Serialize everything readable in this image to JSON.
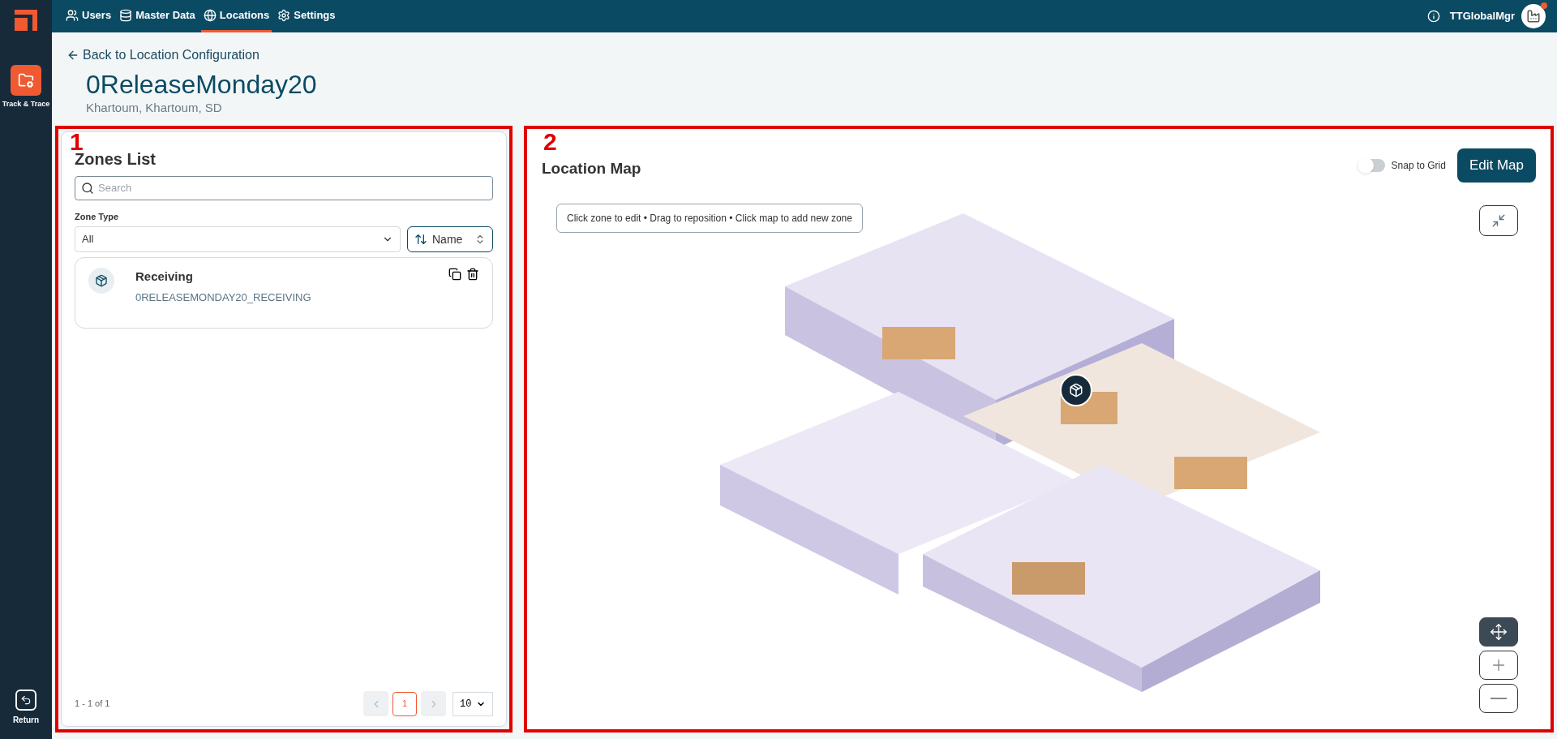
{
  "sidebar": {
    "apps": [
      {
        "label": "Track & Trace",
        "selected": true
      }
    ],
    "return_label": "Return"
  },
  "nav": {
    "tabs": [
      {
        "label": "Users",
        "selected": false
      },
      {
        "label": "Master Data",
        "selected": false
      },
      {
        "label": "Locations",
        "selected": true
      },
      {
        "label": "Settings",
        "selected": false
      }
    ],
    "user": "TTGlobalMgr",
    "notification": true
  },
  "back_link": "Back to Location Configuration",
  "location": {
    "title": "0ReleaseMonday20",
    "subtitle": "Khartoum, Khartoum, SD"
  },
  "annotations": [
    "1",
    "2"
  ],
  "zones_panel": {
    "title": "Zones List",
    "search": {
      "placeholder": "Search"
    },
    "zone_type_label": "Zone Type",
    "zone_type_value": "All",
    "sort_label": "Name",
    "zones": [
      {
        "name": "Receiving",
        "code": "0RELEASEMONDAY20_RECEIVING"
      }
    ],
    "range": "1 - 1 of 1",
    "pagination": {
      "prev_disabled": true,
      "next_disabled": true,
      "pages": [
        {
          "label": "1",
          "selected": true
        }
      ]
    },
    "page_size": "10"
  },
  "map_panel": {
    "title": "Location Map",
    "snap_label": "Snap to Grid",
    "snap_on": false,
    "edit_button": "Edit Map",
    "hint": "Click zone to edit • Drag to reposition • Click map to add new zone",
    "tools": [
      {
        "kind": "pan",
        "selected": true
      },
      {
        "kind": "zoom_in",
        "selected": false
      },
      {
        "kind": "zoom_out",
        "selected": false
      }
    ]
  }
}
